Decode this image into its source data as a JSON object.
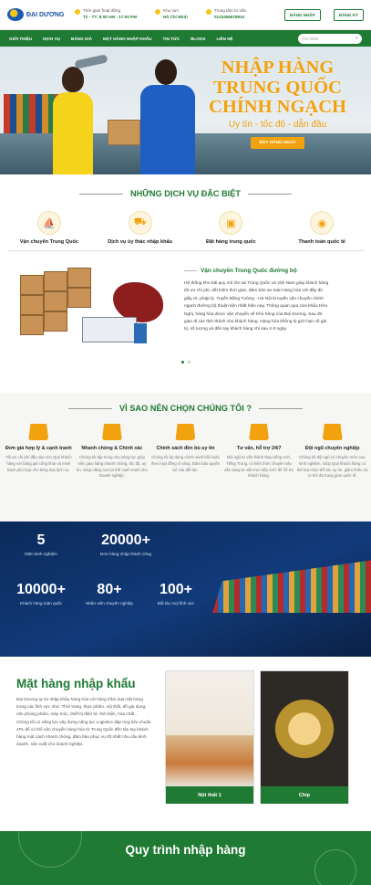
{
  "header": {
    "logo_text": "ĐẠI DƯƠNG",
    "hours_label": "Thời gian hoạt động",
    "hours_value": "T2 - T7: 8:00 AM - 17:00 PM",
    "area_label": "Khu vực",
    "area_value": "Hồ Chí Minh",
    "hotline_label": "Trung tâm tư vấn",
    "hotline_value": "0123456578910",
    "login_label": "ĐĂNG NHẬP",
    "register_label": "ĐĂNG KÝ"
  },
  "nav": {
    "items": [
      "GIỚI THIỆU",
      "DỊCH VỤ",
      "BẢNG GIÁ",
      "MẶT HÀNG NHẬP KHẨU",
      "TIN TỨC",
      "BLOGS",
      "LIÊN HỆ"
    ],
    "search_placeholder": "Tìm kiếm"
  },
  "hero": {
    "title": "NHẬP HÀNG TRUNG QUỐC CHÍNH NGẠCH",
    "subtitle": "Uy tín - tốc độ - dẫn đầu",
    "cta": "ĐẶT HÀNG NGAY"
  },
  "services": {
    "title": "NHỮNG DỊCH VỤ ĐẶC BIỆT",
    "tabs": [
      {
        "label": "Vận chuyển Trung Quốc",
        "icon": "ship-icon"
      },
      {
        "label": "Dịch vụ ủy thác nhập khẩu",
        "icon": "truck-icon"
      },
      {
        "label": "Đặt hàng trung quốc",
        "icon": "box-icon"
      },
      {
        "label": "Thanh toán quốc tế",
        "icon": "money-icon"
      }
    ],
    "detail_title": "Vận chuyển Trung Quốc đường bộ",
    "detail_text": "Hệ thống kho bãi quy mô lớn tại Trung Quốc và Việt Nam giúp khách hàng tối ưu chi phí, tiết kiệm thời gian, đảm bảo an toàn hàng hóa với đầy đủ giấy tờ, pháp lý. Tuyến Bằng Tường - Hà Nội là tuyến vận chuyển chính ngạch đường bộ thuận tiện nhất hiện nay. Thông quan qua cửa khẩu Hữu Nghị, hàng hóa được vận chuyển về Kho hàng của Đại Dương. Sau đó giao đi các tỉnh thành cho khách hàng. Hàng hóa không bị giới hạn về giá trị, số lượng và đến tay khách hàng chỉ sau 2-3 ngày."
  },
  "why": {
    "title": "VÌ SAO NÊN CHỌN CHÚNG TÔI ?",
    "items": [
      {
        "title": "Đơn giá hợp lý & cạnh tranh",
        "text": "Tối ưu chi phí đầu vào cho Quý khách hàng với bảng giá công khai và minh bạch phù hợp cho từng loại dịch vụ."
      },
      {
        "title": "Nhanh chóng & Chính xác",
        "text": "Chúng tôi tập trung cho năng lực giúp việc giao hàng nhanh chóng, tốc độ, uy tín. Giúp năng cao lợi thế cạnh tranh cho Doanh nghiệp."
      },
      {
        "title": "Chính sách đền bù uy tín",
        "text": "Chúng tôi áp dụng chính sách bồi hoàn theo hợp đồng rõ ràng. Đảm bảo quyền lợi của đối tác."
      },
      {
        "title": "Tư vấn, hỗ trợ 24/7",
        "text": "Đội ngũ tư vấn thành thạo tiếng Anh, Tiếng Trung, có kiến thức chuyên sâu sẵn sàng tư vấn trực tiếp 24/7 để hỗ trợ khách hàng."
      },
      {
        "title": "Đội ngũ chuyên nghiệp",
        "text": "Chúng tôi đội ngũ có chuyên môn cao, kinh nghiệm. Giúp Quý khách hàng có thể lựa chọn đối tác uy tín, giảm thiểu rủi ro bởi đa trung gian quốc tế."
      }
    ]
  },
  "stats": [
    {
      "value": "5",
      "label": "Năm kinh nghiệm"
    },
    {
      "value": "20000+",
      "label": "Đơn hàng nhập thành công"
    },
    {
      "value": "10000+",
      "label": "Khách hàng toàn quốc"
    },
    {
      "value": "80+",
      "label": "Nhân viên chuyên nghiệp"
    },
    {
      "value": "100+",
      "label": "Đối tác mọi lĩnh vực"
    }
  ],
  "import_goods": {
    "title": "Mặt hàng nhập khẩu",
    "text": "Đại Dương tự tin nhập khẩu hàng hóa với hàng trăm loại mặt hàng trong các lĩnh vực như: Thời trang, thực phẩm, nội thất, đồ gia dụng, văn phòng phẩm, máy móc, thiết bị điện tử, linh kiện, hóa chất... Chúng tôi có năng lực xây dựng năng lực Logistics đáp ứng tiêu chuẩn 4PL để có thể vận chuyển hàng hóa từ Trung Quốc đến tận tay khách hàng một cách nhanh chóng, đảm bảo phục vụ tốt nhất nhu cầu kinh doanh, sản xuất cho doanh nghiệp.",
    "cards": [
      "Nội thất 1",
      "Chip"
    ]
  },
  "process": {
    "title": "Quy trình nhập hàng"
  },
  "colors": {
    "brand_green": "#1f7a34",
    "accent_orange": "#f2a20f"
  }
}
